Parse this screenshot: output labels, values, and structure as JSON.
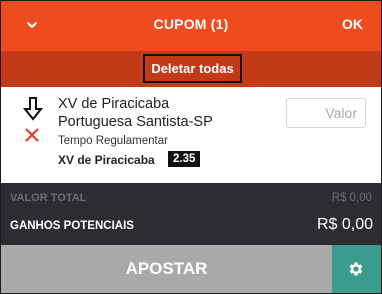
{
  "header": {
    "title": "CUPOM (1)",
    "ok_label": "OK",
    "collapse_icon": "chevron-down-icon",
    "bg_color": "#f04a1f"
  },
  "delete_bar": {
    "delete_all_label": "Deletar todas",
    "bg_color": "#c23a18"
  },
  "bet": {
    "team_home": "XV de Piracicaba",
    "team_away": "Portuguesa Santista-SP",
    "market": "Tempo Regulamentar",
    "selection": "XV de Piracicaba",
    "odds": "2.35",
    "stake_placeholder": "Valor",
    "stake_value": "",
    "icons": [
      "arrow-down-icon",
      "close-icon"
    ]
  },
  "totals": {
    "total_label": "VALOR TOTAL",
    "total_value": "R$ 0,00",
    "gain_label": "GANHOS POTENCIAIS",
    "gain_value": "R$ 0,00",
    "bg_color": "#2e2c30"
  },
  "footer": {
    "place_bet_label": "APOSTAR",
    "place_bet_color": "#a9a9a9",
    "settings_icon": "gear-icon",
    "settings_color": "#3a9c8c"
  }
}
